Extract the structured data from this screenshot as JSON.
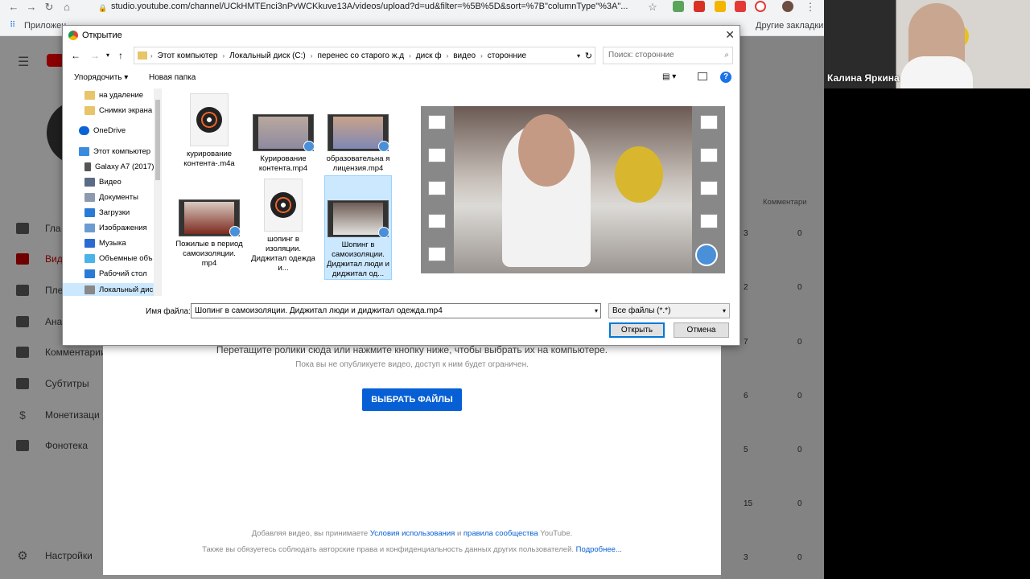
{
  "browser": {
    "url": "studio.youtube.com/channel/UCkHMTEnci3nPvWCKkuve13A/videos/upload?d=ud&filter=%5B%5D&sort=%7B\"columnType\"%3A\"...",
    "bookmarks_apps": "Приложен",
    "bookmarks_other": "Другие закладки"
  },
  "sidebar": {
    "items": [
      {
        "label": "Гла",
        "icon": "dashboard-icon"
      },
      {
        "label": "Вид",
        "icon": "video-icon"
      },
      {
        "label": "Пле",
        "icon": "playlist-icon"
      },
      {
        "label": "Ана",
        "icon": "analytics-icon"
      },
      {
        "label": "Комментарии",
        "icon": "comments-icon"
      },
      {
        "label": "Субтитры",
        "icon": "subtitles-icon"
      },
      {
        "label": "Монетизаци",
        "icon": "dollar-icon"
      },
      {
        "label": "Фонотека",
        "icon": "music-library-icon"
      }
    ],
    "settings": "Настройки"
  },
  "table": {
    "comments_header": "Комментари",
    "rows": [
      [
        "3",
        "0"
      ],
      [
        "2",
        "0"
      ],
      [
        "7",
        "0"
      ],
      [
        "6",
        "0"
      ],
      [
        "5",
        "0"
      ],
      [
        "15",
        "0"
      ],
      [
        "3",
        "0"
      ]
    ]
  },
  "upload": {
    "drag_text": "Перетащите ролики сюда или нажмите кнопку ниже, чтобы выбрать их на компьютере.",
    "sub_text": "Пока вы не опубликуете видео, доступ к ним будет ограничен.",
    "select_button": "ВЫБРАТЬ ФАЙЛЫ",
    "legal1_a": "Добавляя видео, вы принимаете ",
    "legal1_link1": "Условия использования",
    "legal1_b": " и ",
    "legal1_link2": "правила сообщества",
    "legal1_c": " YouTube.",
    "legal2": "Также вы обязуетесь соблюдать авторские права и конфиденциальность данных других пользователей. ",
    "legal2_link": "Подробнее..."
  },
  "dialog": {
    "title": "Открытие",
    "breadcrumbs": [
      "Этот компьютер",
      "Локальный диск (C:)",
      "перенес со старого ж.д",
      "диск ф",
      "видео",
      "сторонние"
    ],
    "search_placeholder": "Поиск: сторонние",
    "organize": "Упорядочить ▾",
    "new_folder": "Новая папка",
    "tree": [
      {
        "label": "на удаление",
        "icon": "folder-icon",
        "color": "#e8c46a"
      },
      {
        "label": "Снимки экрана",
        "icon": "folder-icon",
        "color": "#e8c46a"
      },
      {
        "label": "OneDrive",
        "icon": "cloud-icon",
        "color": "#0a64d6"
      },
      {
        "label": "Этот компьютер",
        "icon": "computer-icon",
        "color": "#3a8dde"
      },
      {
        "label": "Galaxy A7 (2017)",
        "icon": "phone-icon",
        "color": "#555555"
      },
      {
        "label": "Видео",
        "icon": "video-folder-icon",
        "color": "#5b6b85"
      },
      {
        "label": "Документы",
        "icon": "documents-icon",
        "color": "#8d9aae"
      },
      {
        "label": "Загрузки",
        "icon": "downloads-icon",
        "color": "#2a7bd6"
      },
      {
        "label": "Изображения",
        "icon": "pictures-icon",
        "color": "#6b9bd1"
      },
      {
        "label": "Музыка",
        "icon": "music-icon",
        "color": "#2a6ad1"
      },
      {
        "label": "Объемные объ",
        "icon": "3d-objects-icon",
        "color": "#4ab3e8"
      },
      {
        "label": "Рабочий стол",
        "icon": "desktop-icon",
        "color": "#2a7bd6"
      },
      {
        "label": "Локальный дис",
        "icon": "drive-icon",
        "color": "#888888"
      }
    ],
    "files": [
      {
        "label": "курирование контента-.m4a",
        "kind": "audio"
      },
      {
        "label": "Курирование контента.mp4",
        "kind": "video"
      },
      {
        "label": "образовательна я лицензия.mp4",
        "kind": "video"
      },
      {
        "label": "Пожилые в период самоизоляции. mp4",
        "kind": "video"
      },
      {
        "label": "шопинг в изоляции. Диджитал одежда и...",
        "kind": "audio"
      },
      {
        "label": "Шопинг в самоизоляции. Диджитал люди и диджитал од...",
        "kind": "video"
      }
    ],
    "filename_label": "Имя файла:",
    "filename_value": "Шопинг в самоизоляции. Диджитал люди и диджитал одежда.mp4",
    "filetype": "Все файлы (*.*)",
    "open_button": "Открыть",
    "cancel_button": "Отмена"
  },
  "webcam": {
    "name": "Калина Яркина"
  }
}
